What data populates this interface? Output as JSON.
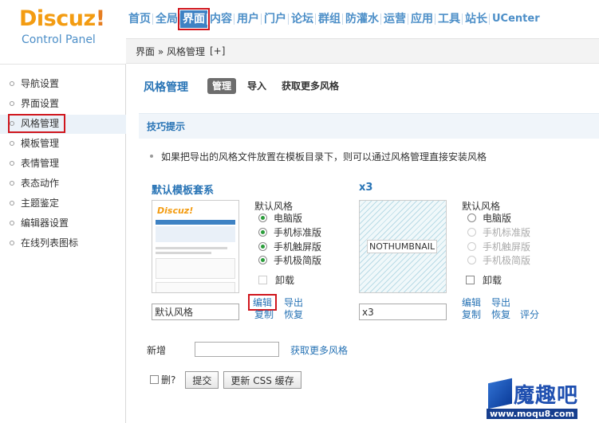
{
  "logo": {
    "title": "Discuz",
    "title_mark": "!",
    "subtitle": "Control Panel"
  },
  "topnav": [
    {
      "label": "首页"
    },
    {
      "label": "全局"
    },
    {
      "label": "界面"
    },
    {
      "label": "内容"
    },
    {
      "label": "用户"
    },
    {
      "label": "门户"
    },
    {
      "label": "论坛"
    },
    {
      "label": "群组"
    },
    {
      "label": "防灌水"
    },
    {
      "label": "运营"
    },
    {
      "label": "应用"
    },
    {
      "label": "工具"
    },
    {
      "label": "站长"
    },
    {
      "label": "UCenter"
    }
  ],
  "breadcrumb": {
    "text": "界面 » 风格管理",
    "plus": "[+]"
  },
  "sidebar": [
    {
      "label": "导航设置"
    },
    {
      "label": "界面设置"
    },
    {
      "label": "风格管理"
    },
    {
      "label": "模板管理"
    },
    {
      "label": "表情管理"
    },
    {
      "label": "表态动作"
    },
    {
      "label": "主题鉴定"
    },
    {
      "label": "编辑器设置"
    },
    {
      "label": "在线列表图标"
    }
  ],
  "main": {
    "title": "风格管理",
    "tabs": [
      {
        "label": "管理"
      },
      {
        "label": "导入"
      },
      {
        "label": "获取更多风格"
      }
    ],
    "tips_title": "技巧提示",
    "tip": "如果把导出的风格文件放置在模板目录下，则可以通过风格管理直接安装风格",
    "styles": [
      {
        "name": "默认模板套系",
        "thumb_logo": "Discuz!",
        "group_label": "默认风格",
        "options": [
          "电脑版",
          "手机标准版",
          "手机触屏版",
          "手机极简版"
        ],
        "uninstall": "卸载",
        "input_value": "默认风格",
        "links": [
          "编辑",
          "导出",
          "复制",
          "恢复"
        ]
      },
      {
        "name": "x3",
        "thumb_text": "NOTHUMBNAIL",
        "group_label": "默认风格",
        "options": [
          "电脑版",
          "手机标准版",
          "手机触屏版",
          "手机极简版"
        ],
        "uninstall": "卸载",
        "input_value": "x3",
        "links": [
          "编辑",
          "导出",
          "复制",
          "恢复",
          "评分"
        ]
      }
    ],
    "add_label": "新增",
    "add_link": "获取更多风格",
    "delete_label": "删?",
    "submit_label": "提交",
    "update_css_label": "更新 CSS 缓存"
  },
  "watermark": {
    "text": "魔趣吧",
    "url": "www.moqu8.com"
  },
  "colors": {
    "accent": "#2773b5",
    "nav_active": "#3e82c4",
    "highlight": "#d0161d",
    "radio_checked": "#2a9c3a"
  }
}
